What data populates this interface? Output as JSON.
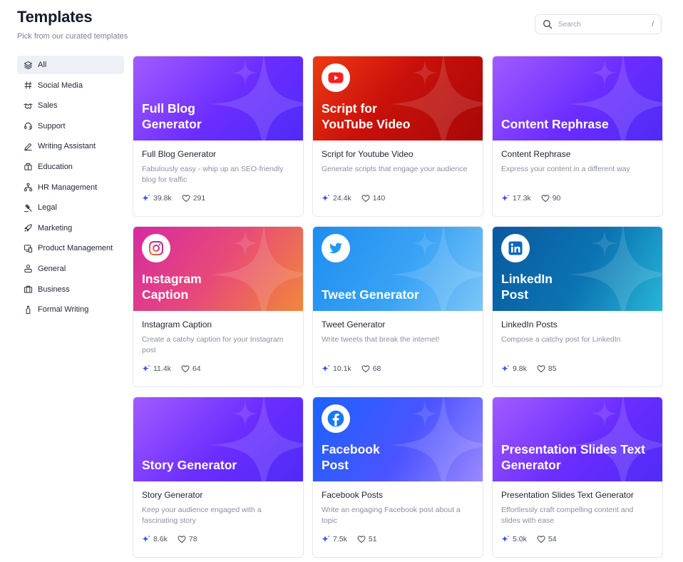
{
  "header": {
    "title": "Templates",
    "subtitle": "Pick from our curated templates"
  },
  "search": {
    "placeholder": "Search",
    "shortcut": "/"
  },
  "sidebar": {
    "items": [
      {
        "label": "All",
        "icon": "layers-icon",
        "active": true
      },
      {
        "label": "Social Media",
        "icon": "hash-icon"
      },
      {
        "label": "Sales",
        "icon": "handshake-icon"
      },
      {
        "label": "Support",
        "icon": "headset-icon"
      },
      {
        "label": "Writing Assistant",
        "icon": "pen-icon"
      },
      {
        "label": "Education",
        "icon": "books-icon"
      },
      {
        "label": "HR Management",
        "icon": "org-chart-icon"
      },
      {
        "label": "Legal",
        "icon": "gavel-icon"
      },
      {
        "label": "Marketing",
        "icon": "rocket-icon"
      },
      {
        "label": "Product Management",
        "icon": "devices-icon"
      },
      {
        "label": "General",
        "icon": "user-tag-icon"
      },
      {
        "label": "Business",
        "icon": "briefcase-icon"
      },
      {
        "label": "Formal Writing",
        "icon": "bottle-icon"
      }
    ]
  },
  "cards": [
    {
      "banner_title": "Full Blog\nGenerator",
      "title": "Full Blog Generator",
      "desc": "Fabulously easy - whip up an SEO-friendly blog for traffic",
      "uses": "39.8k",
      "likes": "291",
      "theme": "purple",
      "logo": ""
    },
    {
      "banner_title": "Script for\nYouTube Video",
      "title": "Script for Youtube Video",
      "desc": "Generate scripts that engage your audience",
      "uses": "24.4k",
      "likes": "140",
      "theme": "red",
      "logo": "youtube-icon"
    },
    {
      "banner_title": "Content Rephrase",
      "title": "Content Rephrase",
      "desc": "Express your content in a different way",
      "uses": "17.3k",
      "likes": "90",
      "theme": "purple",
      "logo": ""
    },
    {
      "banner_title": "Instagram\nCaption",
      "title": "Instagram Caption",
      "desc": "Create a catchy caption for your Instagram post",
      "uses": "11.4k",
      "likes": "64",
      "theme": "insta",
      "logo": "instagram-icon"
    },
    {
      "banner_title": "Tweet Generator",
      "title": "Tweet Generator",
      "desc": "Write tweets that break the internet!",
      "uses": "10.1k",
      "likes": "68",
      "theme": "twitter",
      "logo": "twitter-icon"
    },
    {
      "banner_title": "LinkedIn\nPost",
      "title": "LinkedIn Posts",
      "desc": "Compose a catchy post for LinkedIn",
      "uses": "9.8k",
      "likes": "85",
      "theme": "linkedin",
      "logo": "linkedin-icon"
    },
    {
      "banner_title": "Story Generator",
      "title": "Story Generator",
      "desc": "Keep your audience engaged with a fascinating story",
      "uses": "8.6k",
      "likes": "78",
      "theme": "purple",
      "logo": ""
    },
    {
      "banner_title": "Facebook\nPost",
      "title": "Facebook Posts",
      "desc": "Write an engaging Facebook post about a topic",
      "uses": "7.5k",
      "likes": "51",
      "theme": "facebook",
      "logo": "facebook-icon"
    },
    {
      "banner_title": "Presentation Slides Text\nGenerator",
      "title": "Presentation Slides Text Generator",
      "desc": "Effortlessly craft compelling content and slides with ease",
      "uses": "5.0k",
      "likes": "54",
      "theme": "purple",
      "logo": ""
    }
  ],
  "colors": {
    "accent": "#4f2bf5",
    "sparkle_icon": "#3b4fe0",
    "active_bg": "#eef0f8"
  }
}
